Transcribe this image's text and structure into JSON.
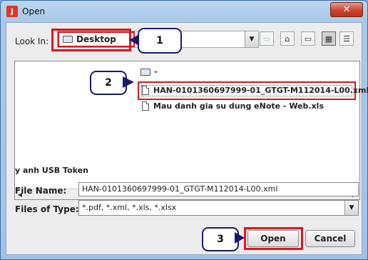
{
  "window": {
    "title": "Open",
    "icon": "app-icon",
    "close_glyph": "✕"
  },
  "lookin": {
    "label": "Look In:",
    "value": "Desktop"
  },
  "toolbar": {
    "up_icon": "up-folder-icon",
    "home_icon": "home-icon",
    "new_folder_icon": "new-folder-icon",
    "list_icon": "list-view-icon",
    "details_icon": "details-view-icon"
  },
  "files": {
    "parent_label": "-",
    "items": [
      {
        "name": "HAN-0101360697999-01_GTGT-M112014-L00.xml"
      },
      {
        "name": "Mau danh gia su dung eNote - Web.xls"
      }
    ],
    "left_partial": "y anh USB Token"
  },
  "file_name": {
    "label": "File Name:",
    "value": "HAN-0101360697999-01_GTGT-M112014-L00.xml"
  },
  "file_type": {
    "label": "Files of Type:",
    "value": "*.pdf, *.xml, *.xls, *.xlsx"
  },
  "buttons": {
    "open": "Open",
    "cancel": "Cancel"
  },
  "callouts": [
    "1",
    "2",
    "3"
  ],
  "colors": {
    "highlight": "#e0141e",
    "callout_border": "#1a1a6a"
  }
}
